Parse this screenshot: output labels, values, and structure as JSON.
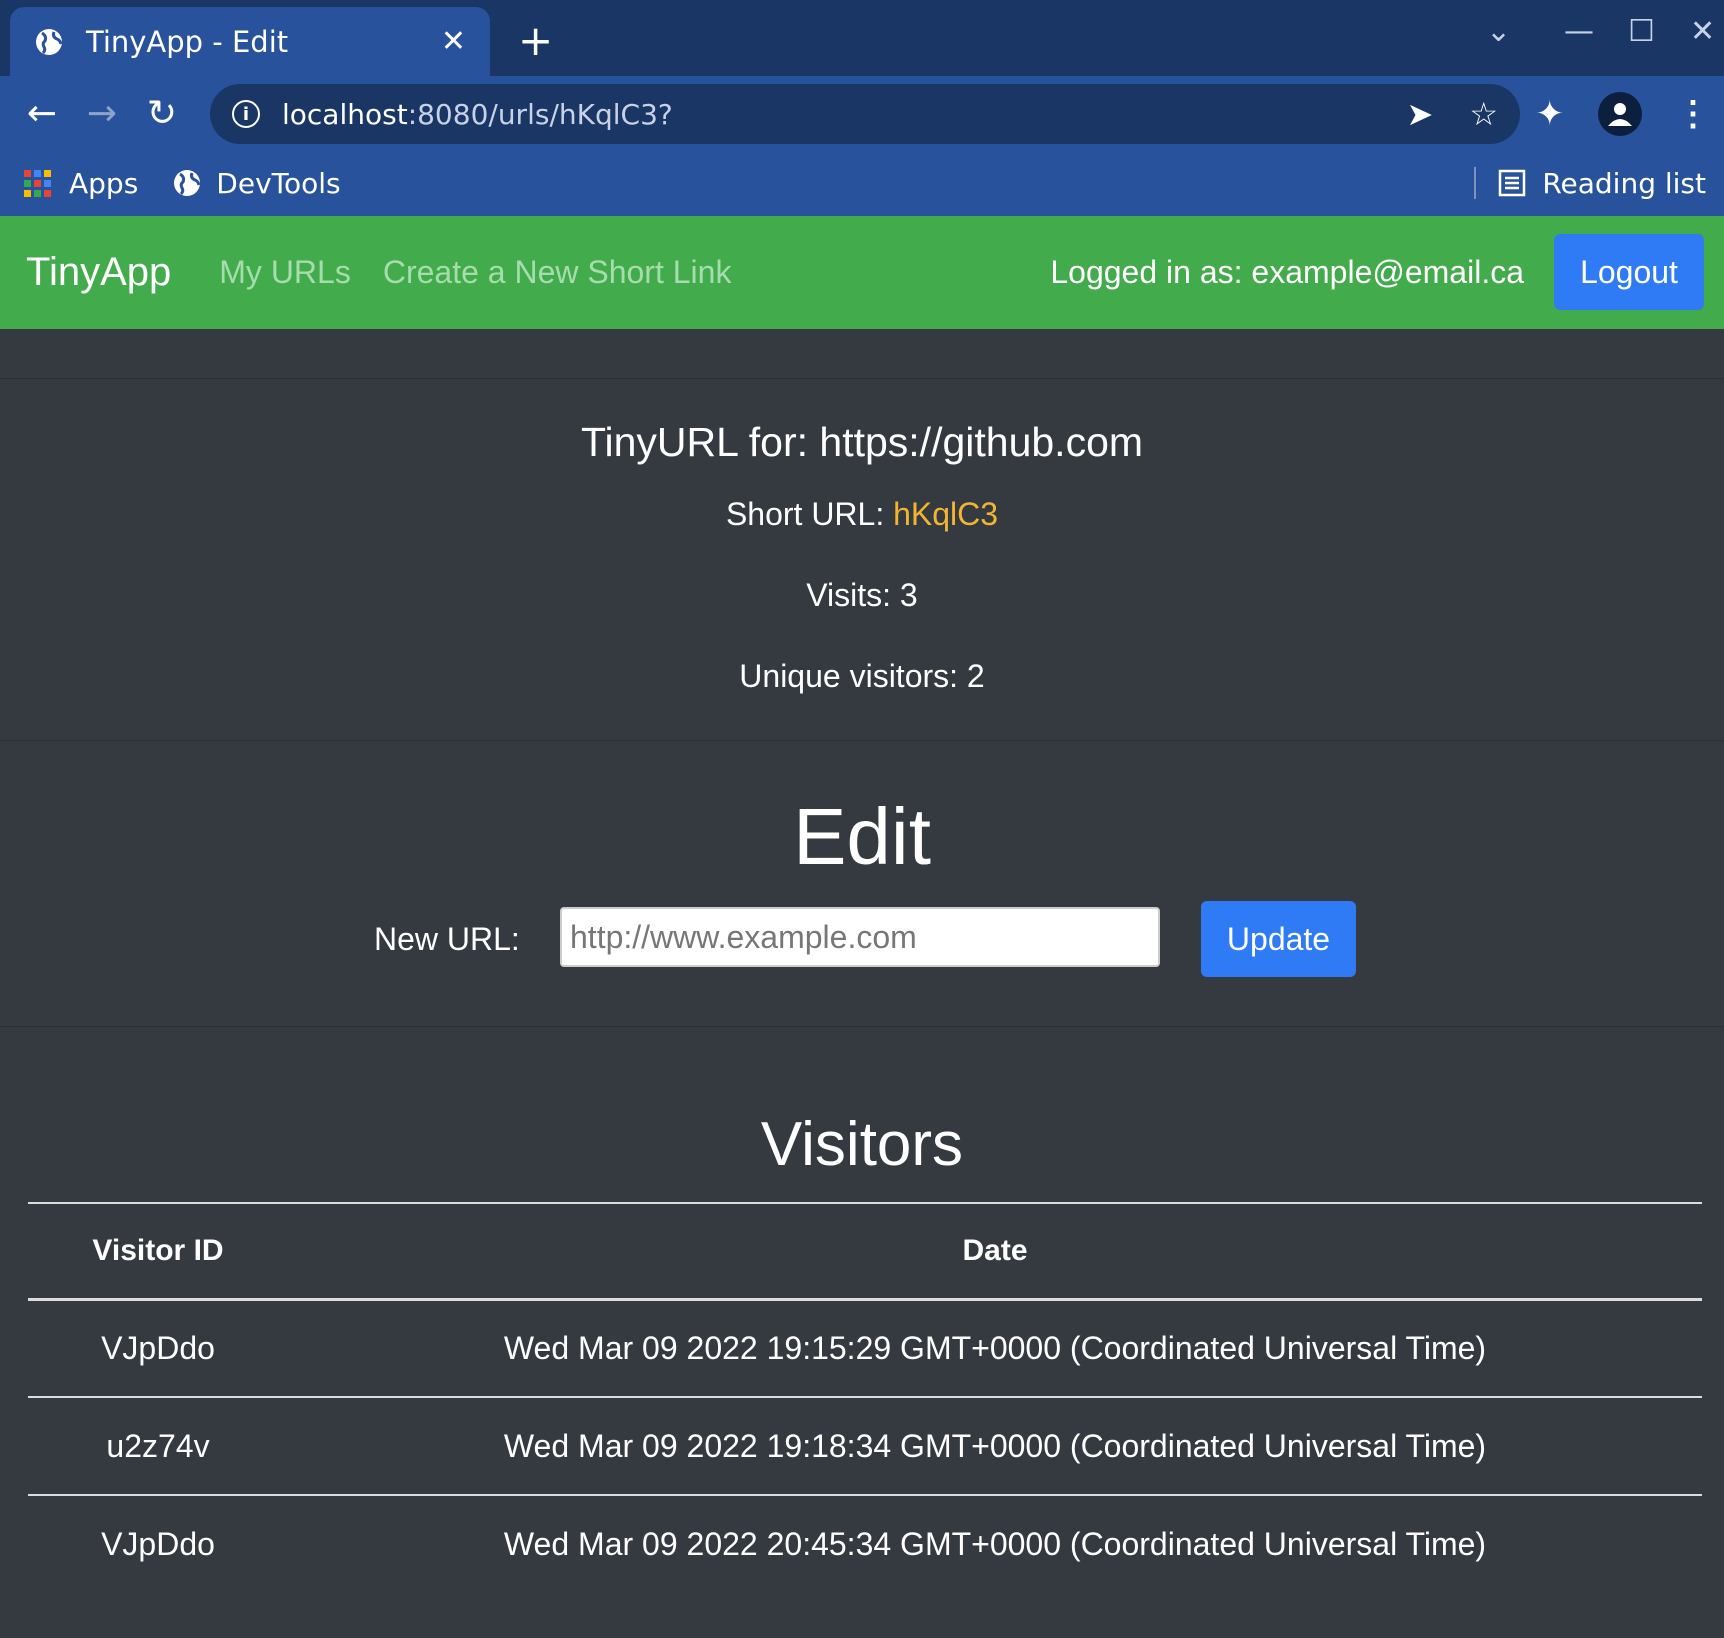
{
  "browser": {
    "tab_title": "TinyApp - Edit",
    "url_host": "localhost",
    "url_rest": ":8080/urls/hKqlC3?",
    "bookmarks": [
      {
        "label": "Apps",
        "icon": "apps-grid-icon"
      },
      {
        "label": "DevTools",
        "icon": "globe-icon"
      }
    ],
    "reading_list": "Reading list"
  },
  "nav": {
    "brand": "TinyApp",
    "my_urls": "My URLs",
    "create": "Create a New Short Link",
    "logged_in": "Logged in as: example@email.ca",
    "logout": "Logout"
  },
  "info": {
    "heading": "TinyURL for: https://github.com",
    "short_label": "Short URL: ",
    "short_code": "hKqlC3",
    "visits": "Visits: 3",
    "unique": "Unique visitors: 2"
  },
  "edit": {
    "title": "Edit",
    "label": "New URL:",
    "placeholder": "http://www.example.com",
    "button": "Update"
  },
  "visitors": {
    "title": "Visitors",
    "headers": [
      "Visitor ID",
      "Date"
    ],
    "rows": [
      {
        "id": "VJpDdo",
        "date": "Wed Mar 09 2022 19:15:29 GMT+0000 (Coordinated Universal Time)"
      },
      {
        "id": "u2z74v",
        "date": "Wed Mar 09 2022 19:18:34 GMT+0000 (Coordinated Universal Time)"
      },
      {
        "id": "VJpDdo",
        "date": "Wed Mar 09 2022 20:45:34 GMT+0000 (Coordinated Universal Time)"
      }
    ]
  },
  "colors": {
    "navbar": "#42ab4b",
    "primary_button": "#2f7bf6",
    "short_code": "#f2b532",
    "page_bg": "#343a40"
  }
}
